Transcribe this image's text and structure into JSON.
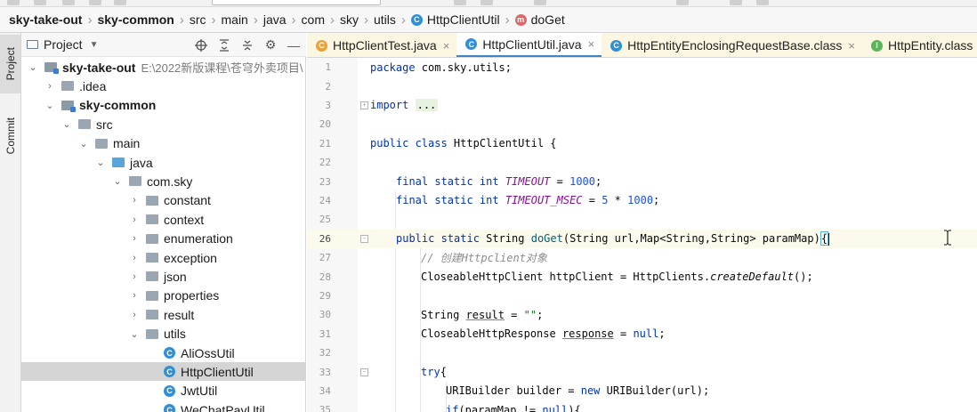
{
  "breadcrumb": {
    "items": [
      "sky-take-out",
      "sky-common",
      "src",
      "main",
      "java",
      "com",
      "sky",
      "utils",
      "HttpClientUtil",
      "doGet"
    ]
  },
  "side_stripe": {
    "project_label": "Project",
    "commit_label": "Commit"
  },
  "project_panel": {
    "title": "Project",
    "tree": [
      {
        "label": "sky-take-out",
        "path": "E:\\2022新版课程\\苍穹外卖项目\\",
        "kind": "module",
        "expanded": true
      },
      {
        "label": ".idea",
        "kind": "folder",
        "expanded": false
      },
      {
        "label": "sky-common",
        "kind": "module",
        "expanded": true
      },
      {
        "label": "src",
        "kind": "folder",
        "expanded": true
      },
      {
        "label": "main",
        "kind": "folder",
        "expanded": true
      },
      {
        "label": "java",
        "kind": "source",
        "expanded": true
      },
      {
        "label": "com.sky",
        "kind": "package",
        "expanded": true
      },
      {
        "label": "constant",
        "kind": "package",
        "expanded": false
      },
      {
        "label": "context",
        "kind": "package",
        "expanded": false
      },
      {
        "label": "enumeration",
        "kind": "package",
        "expanded": false
      },
      {
        "label": "exception",
        "kind": "package",
        "expanded": false
      },
      {
        "label": "json",
        "kind": "package",
        "expanded": false
      },
      {
        "label": "properties",
        "kind": "package",
        "expanded": false
      },
      {
        "label": "result",
        "kind": "package",
        "expanded": false
      },
      {
        "label": "utils",
        "kind": "package",
        "expanded": true
      },
      {
        "label": "AliOssUtil",
        "kind": "class"
      },
      {
        "label": "HttpClientUtil",
        "kind": "class",
        "selected": true
      },
      {
        "label": "JwtUtil",
        "kind": "class"
      },
      {
        "label": "WeChatPayUtil",
        "kind": "class"
      }
    ]
  },
  "tabs": [
    {
      "label": "HttpClientTest.java",
      "icon": "test-class-icon",
      "active": false
    },
    {
      "label": "HttpClientUtil.java",
      "icon": "class-icon",
      "active": true
    },
    {
      "label": "HttpEntityEnclosingRequestBase.class",
      "icon": "class-icon",
      "active": false
    },
    {
      "label": "HttpEntity.class",
      "icon": "interface-icon",
      "active": false
    }
  ],
  "editor": {
    "current_line": "26",
    "lines": [
      {
        "num": "1"
      },
      {
        "num": "2"
      },
      {
        "num": "3"
      },
      {
        "num": "20"
      },
      {
        "num": "21"
      },
      {
        "num": "22"
      },
      {
        "num": "23"
      },
      {
        "num": "24"
      },
      {
        "num": "25"
      },
      {
        "num": "26"
      },
      {
        "num": "27"
      },
      {
        "num": "28"
      },
      {
        "num": "29"
      },
      {
        "num": "30"
      },
      {
        "num": "31"
      },
      {
        "num": "32"
      },
      {
        "num": "33"
      },
      {
        "num": "34"
      },
      {
        "num": "35"
      }
    ],
    "code": {
      "l1_kw": "package",
      "l1_rest": " com.sky.utils;",
      "l3_kw": "import",
      "l3_fold": "...",
      "l21_kw": "public class",
      "l21_rest": " HttpClientUtil {",
      "l23_kw": "final static int",
      "l23_const": "TIMEOUT",
      "l23_eq": " = ",
      "l23_num": "1000",
      "l23_end": ";",
      "l24_kw": "final static int",
      "l24_const": "TIMEOUT_MSEC",
      "l24_eq": " = ",
      "l24_num1": "5",
      "l24_mul": " * ",
      "l24_num2": "1000",
      "l24_end": ";",
      "l26_kw": "public static",
      "l26_type": " String ",
      "l26_method": "doGet",
      "l26_params": "(String url,Map<String,String> paramMap)",
      "l26_brace": "{",
      "l27_comment": "// 创建Httpclient对象",
      "l28_pre": "CloseableHttpClient httpClient = HttpClients.",
      "l28_method": "createDefault",
      "l28_end": "();",
      "l30_pre": "String ",
      "l30_var": "result",
      "l30_eq": " = ",
      "l30_str": "\"\"",
      "l30_end": ";",
      "l31_pre": "CloseableHttpResponse ",
      "l31_var": "response",
      "l31_eq": " = ",
      "l31_kw": "null",
      "l31_end": ";",
      "l33_kw": "try",
      "l33_end": "{",
      "l34_pre": "URIBuilder builder = ",
      "l34_kw": "new",
      "l34_end": " URIBuilder(url);",
      "l35_kw": "if",
      "l35_mid": "(paramMap != ",
      "l35_kw2": "null",
      "l35_end": "){"
    }
  }
}
